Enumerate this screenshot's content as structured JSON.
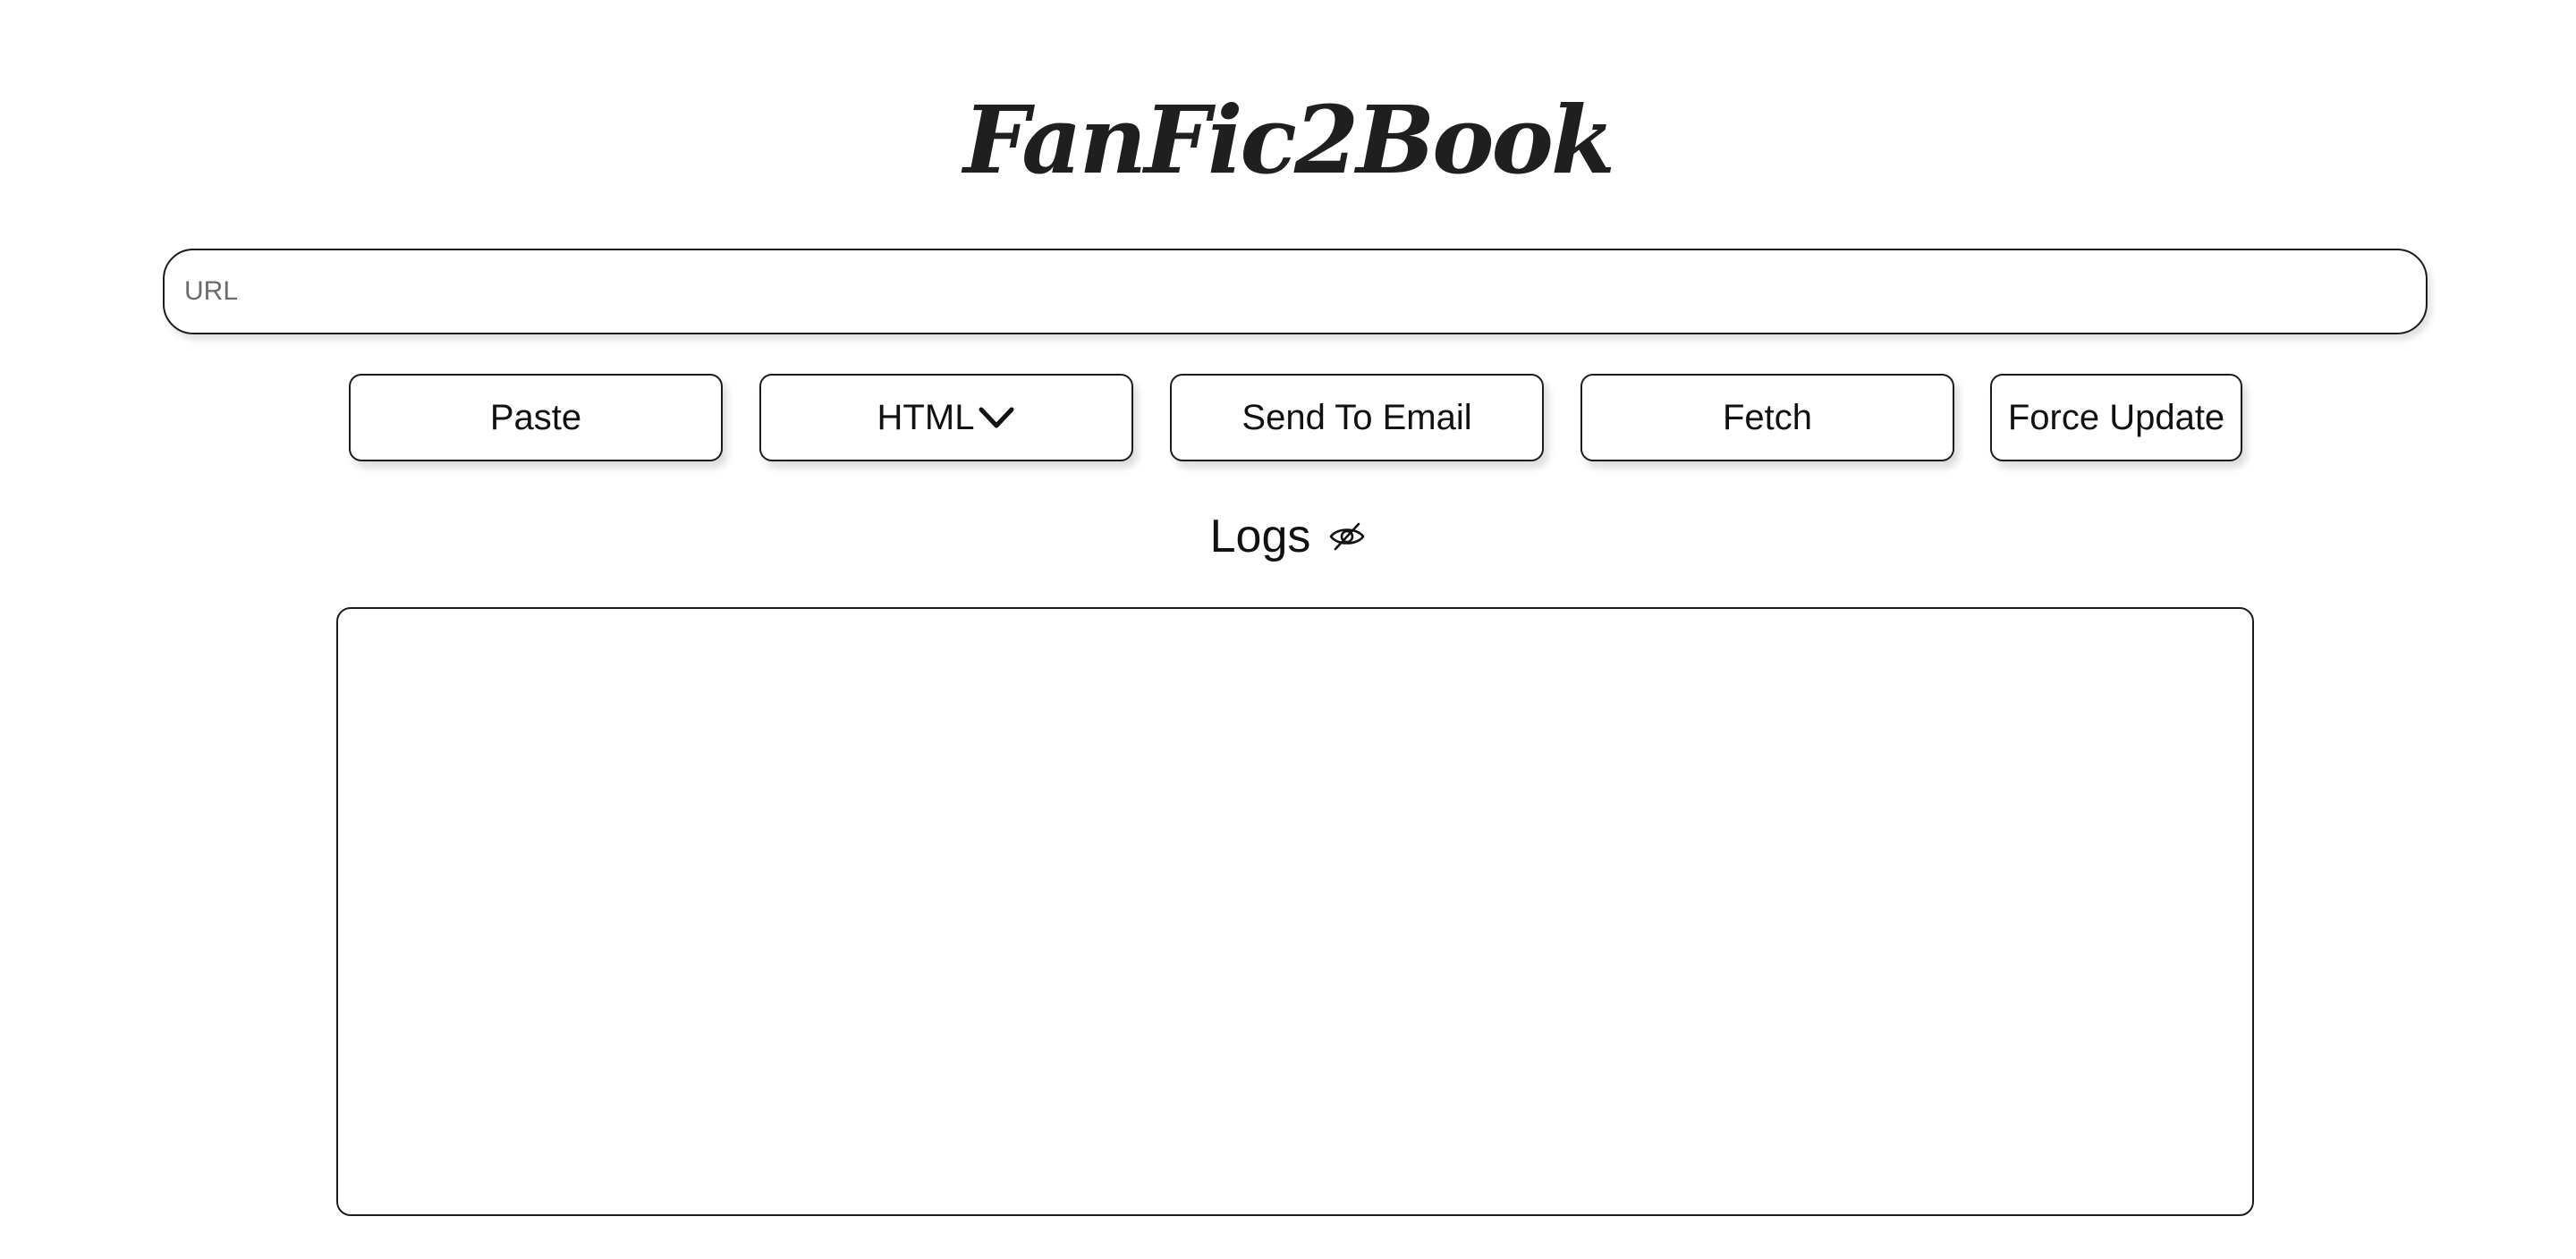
{
  "app": {
    "title": "FanFic2Book"
  },
  "url_input": {
    "placeholder": "URL",
    "value": ""
  },
  "toolbar": {
    "paste_label": "Paste",
    "format_label": "HTML",
    "format_icon": "chevron-down-icon",
    "email_label": "Send To Email",
    "fetch_label": "Fetch",
    "force_update_label": "Force Update"
  },
  "logs": {
    "title": "Logs",
    "visibility_icon": "eye-slash-icon",
    "content": ""
  }
}
